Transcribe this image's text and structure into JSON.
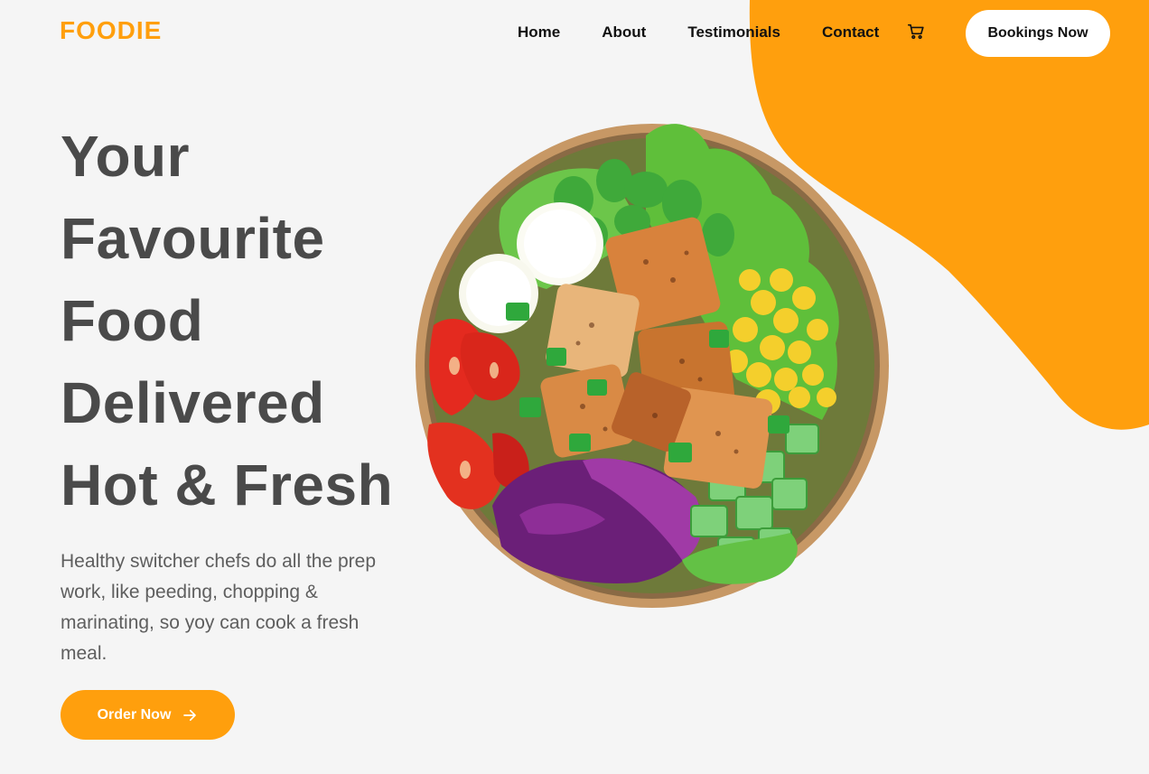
{
  "brand": {
    "logo": "FOODIE",
    "accent_color": "#ff9f0d"
  },
  "nav": {
    "items": [
      {
        "label": "Home"
      },
      {
        "label": "About"
      },
      {
        "label": "Testimonials"
      },
      {
        "label": "Contact"
      }
    ],
    "cart_icon": "cart-icon",
    "booking_label": "Bookings Now"
  },
  "hero": {
    "headline_lines": [
      "Your",
      "Favourite",
      "Food",
      "Delivered",
      "Hot & Fresh"
    ],
    "description": "Healthy switcher chefs do all the prep work, like peeding, chopping & marinating, so yoy can cook a fresh meal.",
    "cta_label": "Order Now",
    "cta_icon": "arrow-right-icon",
    "image": "salad-bowl"
  }
}
